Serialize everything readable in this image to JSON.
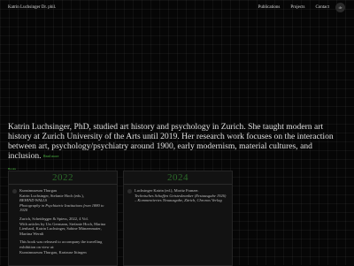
{
  "header": {
    "site_title": "Katrin Luchsinger Dr. phil.",
    "nav": [
      "Publications",
      "Projects",
      "Contact"
    ],
    "lang_badge": "de"
  },
  "bio": {
    "text": "Katrin Luchsinger, PhD, studied art history and psychology in Zurich. She taught modern art history at Zurich University of the Arts until 2019. Her research work focuses on the interaction between art, psychology/psychiatry around 1900, early modernism, material cultures, and inclusion.",
    "more_label": "Read more"
  },
  "publications": {
    "section_label": "Books",
    "cards": [
      {
        "year": "2022",
        "lines": [
          "Kunstmuseum Thurgau",
          "Katrin Luchsinger, Stefanie Hoch (eds.),",
          "BEHIND WALLS",
          "Photography in Psychiatric Institutions from 1880 to 1920",
          "Zurich, Scheidegger & Spiess, 2022, 4 Vol.",
          "With articles by Urs Germann, Stefanie Hoch, Marina Lienhard, Katrin Luchsinger, Sabine Münzenmaier, Martina Wernli",
          "This book was released to accompany the travelling exhibition on view at:",
          "Kunstmuseum Thurgau, Kartause Ittingen"
        ]
      },
      {
        "year": "2024",
        "lines": [
          "Luchsinger Katrin (ed.), Moritz Franzer.",
          "Technisches Schaffen Geisteskranker (Erstausgabe 1926) – Kommentiertes Neuausgabe, Zürich, Chronos Verlag"
        ]
      }
    ]
  }
}
